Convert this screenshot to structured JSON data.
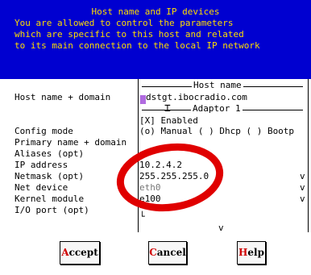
{
  "banner": {
    "title": "Host name and IP devices",
    "lines": [
      "You are allowed to control the parameters",
      "which are specific to this host and related",
      "to its main connection to the local IP network"
    ]
  },
  "labels": {
    "host": "Host name + domain",
    "config": "Config mode",
    "primary": "Primary name + domain",
    "aliases": "Aliases (opt)",
    "ip": "IP address",
    "netmask": "Netmask (opt)",
    "netdev": "Net device",
    "kernel": "Kernel module",
    "ioport": "I/O port (opt)"
  },
  "sections": {
    "host": "Host name",
    "adaptor": "Adaptor 1"
  },
  "fields": {
    "hostname": "dstgt.ibocradio.com",
    "enabled": "[X] Enabled",
    "config_mode": "(o) Manual ( ) Dhcp ( ) Bootp",
    "ip": "10.2.4.2",
    "netmask": "255.255.255.0",
    "netdev": "eth0",
    "kernel": "e100",
    "dropdown_marker": "v"
  },
  "buttons": {
    "accept": {
      "hotkey": "A",
      "rest": "ccept"
    },
    "cancel": {
      "hotkey": "C",
      "rest": "ancel"
    },
    "help": {
      "hotkey": "H",
      "rest": "elp"
    }
  },
  "colors": {
    "banner_bg": "#0000d0",
    "banner_text": "#ffdd00",
    "annotation": "#e00000",
    "hotkey": "#d00000"
  }
}
